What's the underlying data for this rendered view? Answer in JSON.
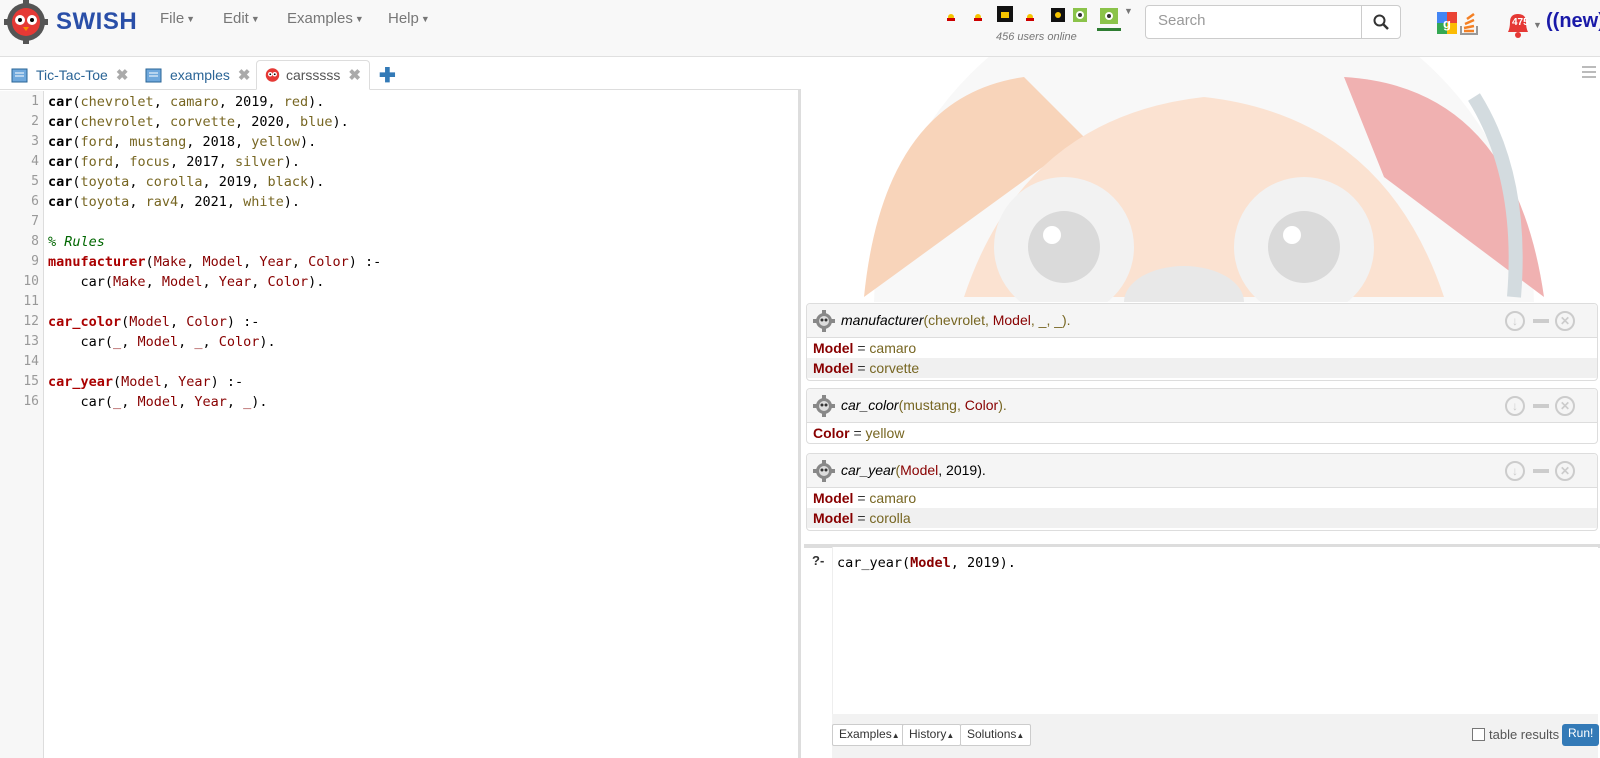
{
  "app": {
    "brand": "SWISH"
  },
  "menu": {
    "file": "File",
    "edit": "Edit",
    "examples": "Examples",
    "help": "Help"
  },
  "users": {
    "online_text": "456 users online"
  },
  "search": {
    "placeholder": "Search"
  },
  "notifications": {
    "count": "475",
    "new_label": "((new))"
  },
  "tabs": [
    {
      "label": "Tic-Tac-Toe",
      "icon": "notebook-icon"
    },
    {
      "label": "examples",
      "icon": "notebook-icon"
    },
    {
      "label": "carsssss",
      "icon": "swish-owl-icon"
    }
  ],
  "editor": {
    "line_numbers": [
      "1",
      "2",
      "3",
      "4",
      "5",
      "6",
      "7",
      "8",
      "9",
      "10",
      "11",
      "12",
      "13",
      "14",
      "15",
      "16"
    ],
    "lines": [
      "car(chevrolet, camaro, 2019, red).",
      "car(chevrolet, corvette, 2020, blue).",
      "car(ford, mustang, 2018, yellow).",
      "car(ford, focus, 2017, silver).",
      "car(toyota, corolla, 2019, black).",
      "car(toyota, rav4, 2021, white).",
      "",
      "% Rules",
      "manufacturer(Make, Model, Year, Color) :-",
      "    car(Make, Model, Year, Color).",
      "",
      "car_color(Model, Color) :-",
      "    car(_, Model, _, Color).",
      "",
      "car_year(Model, Year) :-",
      "    car(_, Model, Year, _)."
    ]
  },
  "queries": [
    {
      "pred": "manufacturer",
      "args_a": "(chevrolet, ",
      "var": "Model",
      "args_b": ", _, _).",
      "answers": [
        {
          "var": "Model",
          "value": "camaro"
        },
        {
          "var": "Model",
          "value": "corvette"
        }
      ]
    },
    {
      "pred": "car_color",
      "args_a": "(mustang, ",
      "var": "Color",
      "args_b": ").",
      "answers": [
        {
          "var": "Color",
          "value": "yellow"
        }
      ]
    },
    {
      "pred": "car_year",
      "args_a": "(",
      "var": "Model",
      "args_b": ", 2019).",
      "answers": [
        {
          "var": "Model",
          "value": "camaro"
        },
        {
          "var": "Model",
          "value": "corolla"
        }
      ]
    }
  ],
  "query_editor": {
    "prompt": "?-",
    "pred": "car_year(",
    "var": "Model",
    "rest": ", 2019)."
  },
  "footer": {
    "examples": "Examples",
    "history": "History",
    "solutions": "Solutions",
    "table_results": "table results",
    "run": "Run!"
  },
  "colors": {
    "accent": "#337ab7",
    "variable": "#880000",
    "atom": "#776622",
    "brand_blue": "#2a4fa8"
  }
}
